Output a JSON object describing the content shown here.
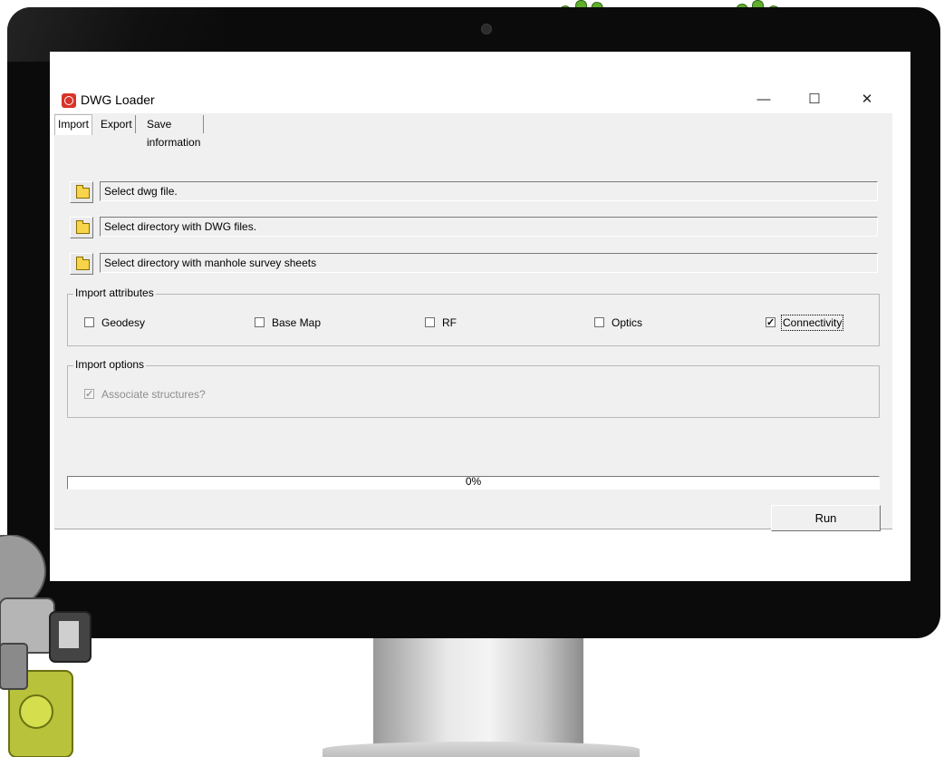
{
  "window": {
    "title": "DWG Loader",
    "minimize_glyph": "—",
    "maximize_glyph": "☐",
    "close_glyph": "✕"
  },
  "tabs": [
    {
      "label": "Import",
      "active": true
    },
    {
      "label": "Export",
      "active": false
    },
    {
      "label": "Save information",
      "active": false
    }
  ],
  "file_inputs": [
    {
      "value": "Select dwg file.",
      "icon": "folder-icon"
    },
    {
      "value": "Select directory with DWG files.",
      "icon": "folder-icon"
    },
    {
      "value": "Select directory with manhole survey sheets",
      "icon": "folder-icon"
    }
  ],
  "import_attributes": {
    "label": "Import attributes",
    "options": [
      {
        "label": "Geodesy",
        "checked": false
      },
      {
        "label": "Base Map",
        "checked": false
      },
      {
        "label": "RF",
        "checked": false
      },
      {
        "label": "Optics",
        "checked": false
      },
      {
        "label": "Connectivity",
        "checked": true
      }
    ]
  },
  "import_options": {
    "label": "Import options",
    "associate_structures": {
      "label": "Associate structures?",
      "checked": true,
      "disabled": true
    }
  },
  "progress": {
    "value": 0,
    "text": "0%"
  },
  "run_button": {
    "label": "Run"
  },
  "colors": {
    "window_bg": "#f0f0f0",
    "app_icon": "#d8342a",
    "monitor_bezel": "#0b0b0b",
    "frog_green": "#5fae2e"
  }
}
